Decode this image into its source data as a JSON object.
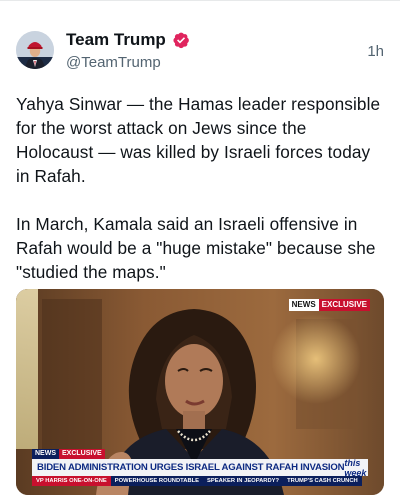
{
  "post": {
    "author": {
      "display_name": "Team Trump",
      "handle": "@TeamTrump",
      "verified_icon": "verified-badge-icon",
      "avatar_icon": "profile-avatar"
    },
    "timestamp": "1h",
    "text": {
      "paragraph_1": "Yahya Sinwar — the Hamas leader responsible for the worst attack on Jews since the Holocaust — was killed by Israeli forces today in Rafah.",
      "paragraph_2": "In March, Kamala said an Israeli offensive in Rafah would be a \"huge mistake\" because she \"studied the maps.\""
    },
    "media": {
      "network_badge": "NEWS",
      "exclusive_badge": "EXCLUSIVE",
      "chyron_network": "NEWS",
      "chyron_exclusive": "EXCLUSIVE",
      "headline": "BIDEN ADMINISTRATION URGES ISRAEL AGAINST RAFAH INVASION",
      "show_logo": "this week",
      "ticker": [
        "VP HARRIS ONE-ON-ONE",
        "POWERHOUSE ROUNDTABLE",
        "SPEAKER IN JEOPARDY?",
        "TRUMP'S CASH CRUNCH"
      ]
    }
  },
  "colors": {
    "text_primary": "#0f1419",
    "text_secondary": "#536471",
    "verified": "#e0245e",
    "chyron_blue": "#0d2a82",
    "chyron_red": "#c8102e"
  }
}
